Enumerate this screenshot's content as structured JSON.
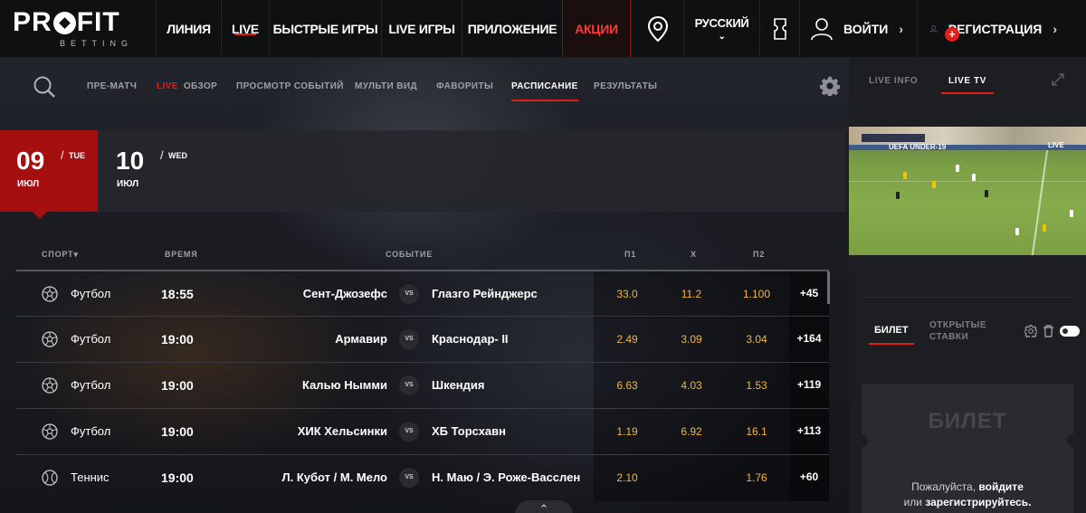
{
  "header": {
    "logo": {
      "pre": "PR",
      "post": "FIT",
      "sub": "BETTING"
    },
    "nav": [
      {
        "label": "ЛИНИЯ"
      },
      {
        "label": "LIVE"
      },
      {
        "label": "БЫСТРЫЕ ИГРЫ"
      },
      {
        "label": "LIVE ИГРЫ"
      },
      {
        "label": "ПРИЛОЖЕНИЕ"
      },
      {
        "label": "АКЦИИ"
      }
    ],
    "language": "РУССКИЙ",
    "login": "ВОЙТИ",
    "register": "РЕГИСТРАЦИЯ"
  },
  "subnav": {
    "prematch": "ПРЕ-МАТЧ",
    "live_prefix": "LIVE",
    "overview": "ОБЗОР",
    "events_view": "ПРОСМОТР СОБЫТИЙ",
    "multiview": "МУЛЬТИ ВИД",
    "favorites": "ФАВОРИТЫ",
    "schedule": "РАСПИСАНИЕ",
    "results": "РЕЗУЛЬТАТЫ"
  },
  "dates": [
    {
      "num": "09",
      "day": "TUE",
      "month": "ИЮЛ",
      "active": true
    },
    {
      "num": "10",
      "day": "WED",
      "month": "ИЮЛ",
      "active": false
    }
  ],
  "columns": {
    "sport": "СПОРТ",
    "time": "ВРЕМЯ",
    "event": "СОБЫТИЕ",
    "p1": "П1",
    "x": "Х",
    "p2": "П2"
  },
  "rows": [
    {
      "sport": "Футбол",
      "time": "18:55",
      "team1": "Сент-Джозефс",
      "team2": "Глазго Рейнджерс",
      "p1": "33.0",
      "x": "11.2",
      "p2": "1.100",
      "more": "+45"
    },
    {
      "sport": "Футбол",
      "time": "19:00",
      "team1": "Армавир",
      "team2": "Краснодар- II",
      "p1": "2.49",
      "x": "3.09",
      "p2": "3.04",
      "more": "+164"
    },
    {
      "sport": "Футбол",
      "time": "19:00",
      "team1": "Калью Нымми",
      "team2": "Шкендия",
      "p1": "6.63",
      "x": "4.03",
      "p2": "1.53",
      "more": "+119"
    },
    {
      "sport": "Футбол",
      "time": "19:00",
      "team1": "ХИК Хельсинки",
      "team2": "ХБ Торсхавн",
      "p1": "1.19",
      "x": "6.92",
      "p2": "16.1",
      "more": "+113"
    },
    {
      "sport": "Теннис",
      "time": "19:00",
      "team1": "Л. Кубот / М. Мело",
      "team2": "Н. Маю / Э. Роже-Васслен",
      "p1": "2.10",
      "x": "",
      "p2": "1.76",
      "more": "+60"
    }
  ],
  "vs_label": "VS",
  "right": {
    "tab_info": "LIVE INFO",
    "tab_tv": "LIVE TV",
    "video_live": "LIVE",
    "video_badge": "UEFA UNDER-19",
    "slip_tab": "БИЛЕТ",
    "open_bets_1": "ОТКРЫТЫЕ",
    "open_bets_2": "СТАВКИ",
    "ticket_title": "БИЛЕТ",
    "ticket_msg_pre": "Пожалуйста, ",
    "ticket_login": "войдите",
    "ticket_msg_mid": "или ",
    "ticket_register": "зарегистрируйтесь."
  },
  "colors": {
    "accent": "#e31d1a",
    "odds": "#f3b63f",
    "date_active": "#a50f10"
  },
  "icons": [
    "location-icon",
    "coupon-icon",
    "user-icon",
    "search-icon",
    "gear-icon",
    "soccer-ball-icon",
    "tennis-ball-icon",
    "expand-icon",
    "trash-icon"
  ]
}
